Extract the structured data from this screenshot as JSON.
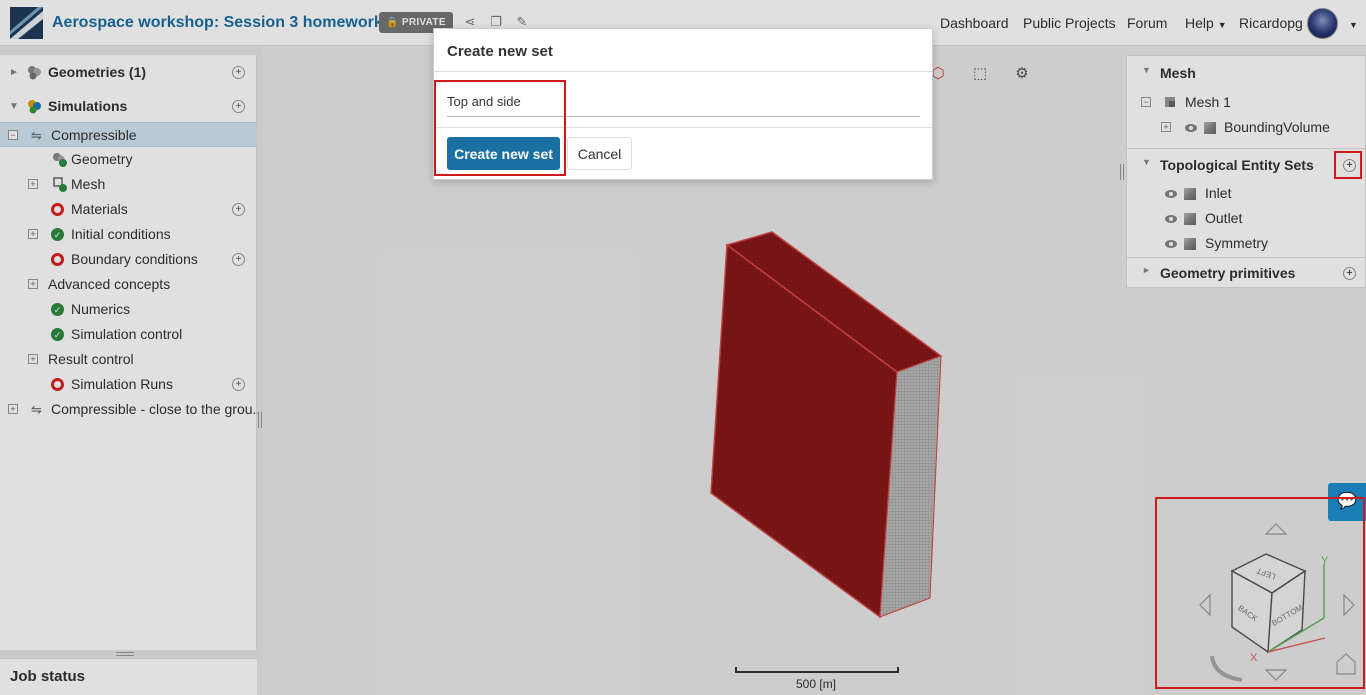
{
  "header": {
    "project_title": "Aerospace workshop: Session 3 homework",
    "private_badge": "PRIVATE",
    "nav": {
      "dashboard": "Dashboard",
      "public_projects": "Public Projects",
      "forum": "Forum",
      "help": "Help",
      "user": "Ricardopg"
    }
  },
  "left_tree": {
    "geometries": "Geometries (1)",
    "simulations": "Simulations",
    "items": [
      {
        "label": "Compressible",
        "status": "none"
      },
      {
        "label": "Geometry",
        "status": "ok"
      },
      {
        "label": "Mesh",
        "status": "ok"
      },
      {
        "label": "Materials",
        "status": "error"
      },
      {
        "label": "Initial conditions",
        "status": "ok"
      },
      {
        "label": "Boundary conditions",
        "status": "error"
      },
      {
        "label": "Advanced concepts",
        "status": "none"
      },
      {
        "label": "Numerics",
        "status": "ok"
      },
      {
        "label": "Simulation control",
        "status": "ok"
      },
      {
        "label": "Result control",
        "status": "none"
      },
      {
        "label": "Simulation Runs",
        "status": "error"
      },
      {
        "label": "Compressible - close to the grou...",
        "status": "none"
      }
    ]
  },
  "job_status": "Job status",
  "right_panel": {
    "mesh_section": "Mesh",
    "mesh_item": "Mesh 1",
    "mesh_child": "BoundingVolume",
    "sets_section": "Topological Entity Sets",
    "sets": [
      "Inlet",
      "Outlet",
      "Symmetry"
    ],
    "primitives_section": "Geometry primitives"
  },
  "dialog": {
    "title": "Create new set",
    "input_value": "Top and side",
    "create_button": "Create new set",
    "cancel_button": "Cancel"
  },
  "viewer": {
    "scale_label": "500 [m]",
    "cube_faces": {
      "top": "LEFT",
      "left": "BACK",
      "right": "BOTTOM"
    },
    "axis_labels": {
      "y": "Y",
      "x": "X"
    }
  },
  "colors": {
    "accent": "#1a6fa3",
    "ok": "#2e8b3f",
    "error": "#d22222",
    "highlight": "#d0191b",
    "model_face": "#8b1a1a"
  }
}
